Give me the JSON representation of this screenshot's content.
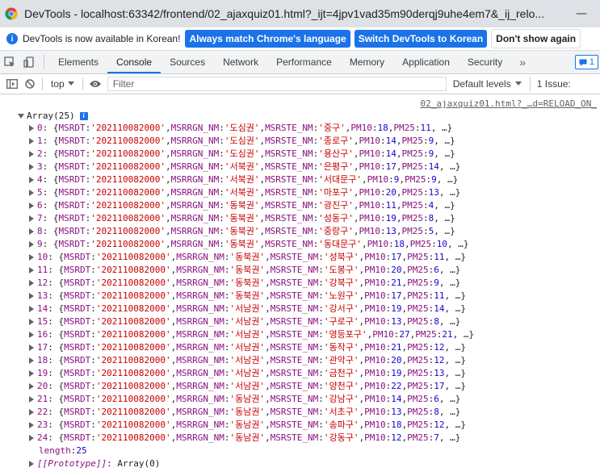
{
  "window": {
    "app_name": "DevTools",
    "title": "DevTools - localhost:63342/frontend/02_ajaxquiz01.html?_ijt=4jpv1vad35m90derqj9uhe4em7&_ij_relo...",
    "minimize_glyph": "—"
  },
  "infobar": {
    "message": "DevTools is now available in Korean!",
    "btn_match": "Always match Chrome's language",
    "btn_switch": "Switch DevTools to Korean",
    "btn_dont_show": "Don't show again"
  },
  "tabs": [
    {
      "label": "Elements",
      "active": false
    },
    {
      "label": "Console",
      "active": true
    },
    {
      "label": "Sources",
      "active": false
    },
    {
      "label": "Network",
      "active": false
    },
    {
      "label": "Performance",
      "active": false
    },
    {
      "label": "Memory",
      "active": false
    },
    {
      "label": "Application",
      "active": false
    },
    {
      "label": "Security",
      "active": false
    }
  ],
  "tabbar": {
    "more_glyph": "»",
    "messages_count": "1"
  },
  "console_toolbar": {
    "context": "top",
    "filter_placeholder": "Filter",
    "levels": "Default levels",
    "issues": "1 Issue:"
  },
  "console": {
    "source_link": "02_ajaxquiz01.html?_…d=RELOAD_ON_",
    "array_label": "Array(25)",
    "info_badge": "i",
    "key_msrdt": "MSRDT",
    "key_msrrgn": "MSRRGN_NM",
    "key_msrste": "MSRSTE_NM",
    "key_pm10": "PM10",
    "key_pm25": "PM25",
    "length_key": "length",
    "length_value": "25",
    "proto_key": "[[Prototype]]",
    "proto_value": "Array(0)",
    "rows": [
      {
        "i": "0",
        "msrdt": "202110082000",
        "rgn": "도심권",
        "ste": "중구",
        "pm10": "18",
        "pm25": "11"
      },
      {
        "i": "1",
        "msrdt": "202110082000",
        "rgn": "도심권",
        "ste": "종로구",
        "pm10": "14",
        "pm25": "9"
      },
      {
        "i": "2",
        "msrdt": "202110082000",
        "rgn": "도심권",
        "ste": "용산구",
        "pm10": "14",
        "pm25": "9"
      },
      {
        "i": "3",
        "msrdt": "202110082000",
        "rgn": "서북권",
        "ste": "은평구",
        "pm10": "17",
        "pm25": "14"
      },
      {
        "i": "4",
        "msrdt": "202110082000",
        "rgn": "서북권",
        "ste": "서대문구",
        "pm10": "9",
        "pm25": "9"
      },
      {
        "i": "5",
        "msrdt": "202110082000",
        "rgn": "서북권",
        "ste": "마포구",
        "pm10": "20",
        "pm25": "13"
      },
      {
        "i": "6",
        "msrdt": "202110082000",
        "rgn": "동북권",
        "ste": "광진구",
        "pm10": "11",
        "pm25": "4"
      },
      {
        "i": "7",
        "msrdt": "202110082000",
        "rgn": "동북권",
        "ste": "성동구",
        "pm10": "19",
        "pm25": "8"
      },
      {
        "i": "8",
        "msrdt": "202110082000",
        "rgn": "동북권",
        "ste": "중랑구",
        "pm10": "13",
        "pm25": "5"
      },
      {
        "i": "9",
        "msrdt": "202110082000",
        "rgn": "동북권",
        "ste": "동대문구",
        "pm10": "18",
        "pm25": "10"
      },
      {
        "i": "10",
        "msrdt": "202110082000",
        "rgn": "동북권",
        "ste": "성북구",
        "pm10": "17",
        "pm25": "11"
      },
      {
        "i": "11",
        "msrdt": "202110082000",
        "rgn": "동북권",
        "ste": "도봉구",
        "pm10": "20",
        "pm25": "6"
      },
      {
        "i": "12",
        "msrdt": "202110082000",
        "rgn": "동북권",
        "ste": "강북구",
        "pm10": "21",
        "pm25": "9"
      },
      {
        "i": "13",
        "msrdt": "202110082000",
        "rgn": "동북권",
        "ste": "노원구",
        "pm10": "17",
        "pm25": "11"
      },
      {
        "i": "14",
        "msrdt": "202110082000",
        "rgn": "서남권",
        "ste": "강서구",
        "pm10": "19",
        "pm25": "14"
      },
      {
        "i": "15",
        "msrdt": "202110082000",
        "rgn": "서남권",
        "ste": "구로구",
        "pm10": "13",
        "pm25": "8"
      },
      {
        "i": "16",
        "msrdt": "202110082000",
        "rgn": "서남권",
        "ste": "영등포구",
        "pm10": "27",
        "pm25": "21"
      },
      {
        "i": "17",
        "msrdt": "202110082000",
        "rgn": "서남권",
        "ste": "동작구",
        "pm10": "21",
        "pm25": "12"
      },
      {
        "i": "18",
        "msrdt": "202110082000",
        "rgn": "서남권",
        "ste": "관악구",
        "pm10": "20",
        "pm25": "12"
      },
      {
        "i": "19",
        "msrdt": "202110082000",
        "rgn": "서남권",
        "ste": "금천구",
        "pm10": "19",
        "pm25": "13"
      },
      {
        "i": "20",
        "msrdt": "202110082000",
        "rgn": "서남권",
        "ste": "양천구",
        "pm10": "22",
        "pm25": "17"
      },
      {
        "i": "21",
        "msrdt": "202110082000",
        "rgn": "동남권",
        "ste": "강남구",
        "pm10": "14",
        "pm25": "6"
      },
      {
        "i": "22",
        "msrdt": "202110082000",
        "rgn": "동남권",
        "ste": "서초구",
        "pm10": "13",
        "pm25": "8"
      },
      {
        "i": "23",
        "msrdt": "202110082000",
        "rgn": "동남권",
        "ste": "송파구",
        "pm10": "18",
        "pm25": "12"
      },
      {
        "i": "24",
        "msrdt": "202110082000",
        "rgn": "동남권",
        "ste": "강동구",
        "pm10": "12",
        "pm25": "7"
      }
    ]
  },
  "icons": {
    "inspect": "inspect-element-icon",
    "device": "device-toolbar-icon",
    "sidebar": "console-sidebar-icon",
    "clear": "clear-console-icon",
    "eye": "live-expression-icon",
    "info": "info-icon",
    "chrome": "chrome-logo-icon"
  },
  "colors": {
    "accent": "#1a73e8",
    "string": "#c80000",
    "key": "#881280",
    "number": "#1c00cf"
  }
}
